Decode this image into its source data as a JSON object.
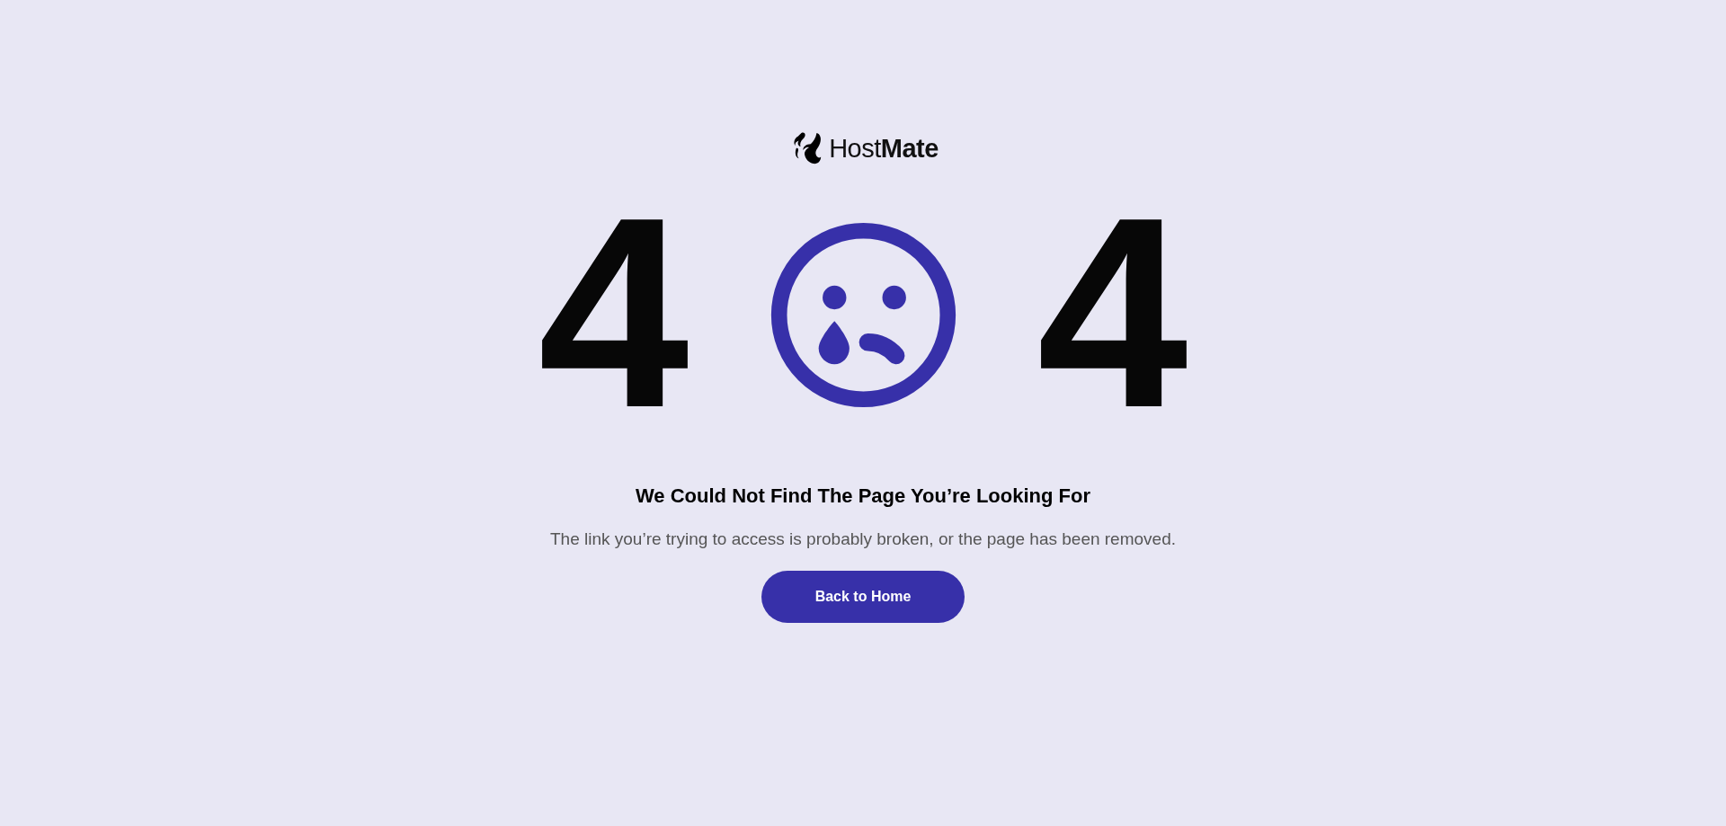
{
  "logo": {
    "text": "Host**Mate**"
  },
  "error_code": {
    "left_digit": "4",
    "right_digit": "4"
  },
  "heading": "We Could Not Find The Page You’re Looking For",
  "message": "The link you’re trying to access is probably broken, or the page has been removed.",
  "button": {
    "label": "Back to Home"
  }
}
